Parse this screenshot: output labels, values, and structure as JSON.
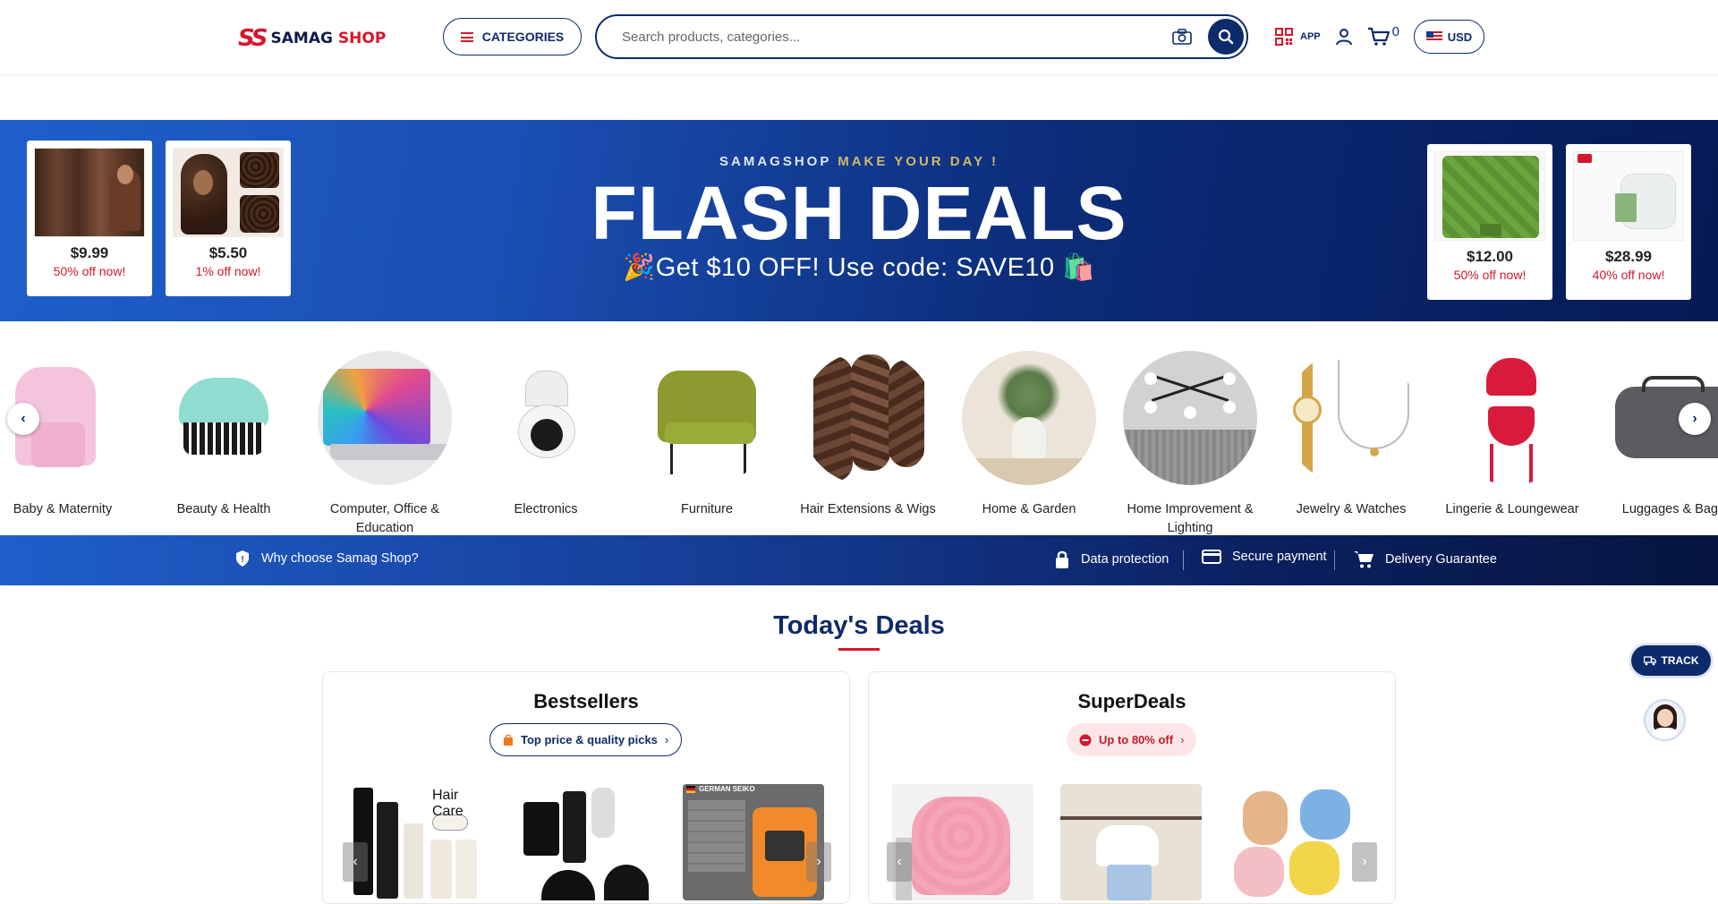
{
  "header": {
    "logo_mark": "SS",
    "logo_word1": "SAMAG",
    "logo_word2": "SHOP",
    "categories_label": "CATEGORIES",
    "search_placeholder": "Search products, categories...",
    "app_label": "APP",
    "cart_count": "0",
    "currency": "USD"
  },
  "banner": {
    "kicker_brand": "SAMAGSHOP",
    "kicker_tag": "MAKE YOUR DAY !",
    "headline": "FLASH DEALS",
    "promo": "🎉Get $10 OFF! Use code: SAVE10 🛍️",
    "left_deals": [
      {
        "price": "$9.99",
        "off": "50% off now!"
      },
      {
        "price": "$5.50",
        "off": "1% off now!"
      }
    ],
    "right_deals": [
      {
        "price": "$12.00",
        "off": "50% off now!"
      },
      {
        "price": "$28.99",
        "off": "40% off now!"
      }
    ]
  },
  "categories": [
    {
      "name": "Baby & Maternity"
    },
    {
      "name": "Beauty & Health"
    },
    {
      "name": "Computer, Office & Education"
    },
    {
      "name": "Electronics"
    },
    {
      "name": "Furniture"
    },
    {
      "name": "Hair Extensions & Wigs"
    },
    {
      "name": "Home & Garden"
    },
    {
      "name": "Home Improvement & Lighting"
    },
    {
      "name": "Jewelry & Watches"
    },
    {
      "name": "Lingerie & Loungewear"
    },
    {
      "name": "Luggages & Bags"
    }
  ],
  "trust": {
    "why": "Why choose Samag Shop?",
    "data": "Data protection",
    "payment": "Secure payment",
    "delivery": "Delivery Guarantee"
  },
  "todays_deals": {
    "title": "Today's Deals",
    "bestsellers": {
      "title": "Bestsellers",
      "pill": "Top price & quality picks",
      "thumb1_text": "Hair Care",
      "thumb3_badge": "GERMAN SEIKO"
    },
    "superdeals": {
      "title": "SuperDeals",
      "pill": "Up to 80% off"
    }
  },
  "floating": {
    "track": "TRACK"
  },
  "colors": {
    "brand_navy": "#0d2a6b",
    "brand_red": "#d5172b",
    "accent_gold": "#d6b66a"
  }
}
